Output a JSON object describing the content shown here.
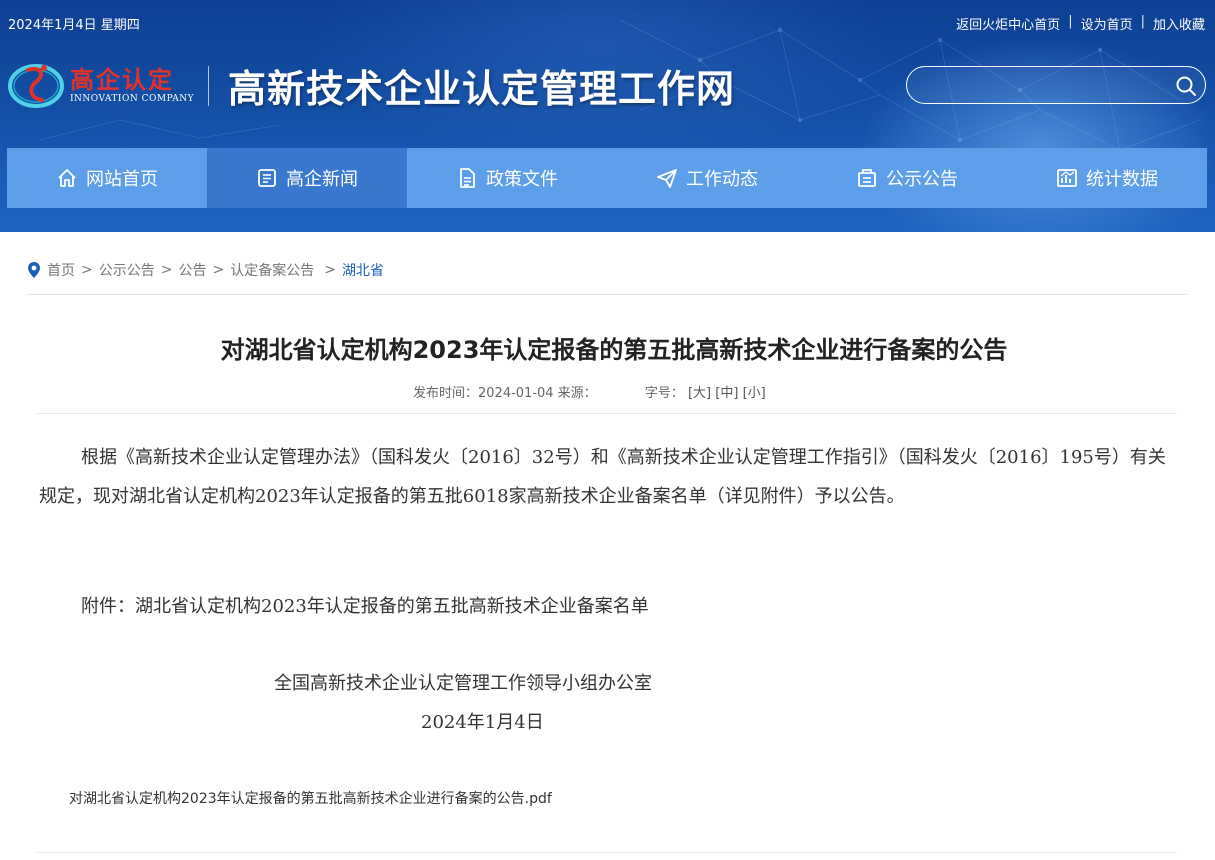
{
  "topbar": {
    "date": "2024年1月4日 星期四",
    "links": [
      "返回火炬中心首页",
      "设为首页",
      "加入收藏"
    ]
  },
  "logo": {
    "cn": "高企认定",
    "en": "INNOVATION COMPANY",
    "icon": "logo-ring-icon"
  },
  "site_title": "高新技术企业认定管理工作网",
  "search": {
    "placeholder": ""
  },
  "nav": {
    "items": [
      {
        "label": "网站首页",
        "icon": "home-icon"
      },
      {
        "label": "高企新闻",
        "icon": "news-icon"
      },
      {
        "label": "政策文件",
        "icon": "document-icon"
      },
      {
        "label": "工作动态",
        "icon": "paper-plane-icon"
      },
      {
        "label": "公示公告",
        "icon": "notice-icon"
      },
      {
        "label": "统计数据",
        "icon": "chart-icon"
      }
    ],
    "active_index": 1
  },
  "breadcrumb": {
    "items": [
      "首页",
      "公示公告",
      "公告",
      "认定备案公告"
    ],
    "current": "湖北省"
  },
  "article": {
    "title": "对湖北省认定机构2023年认定报备的第五批高新技术企业进行备案的公告",
    "meta_publish": "发布时间：2024-01-04 来源：",
    "meta_fontsize_label": "字号：",
    "font_sizes": [
      "[大]",
      "[中]",
      "[小]"
    ],
    "paragraph1": "根据《高新技术企业认定管理办法》（国科发火〔2016〕32号）和《高新技术企业认定管理工作指引》（国科发火〔2016〕195号）有关规定，现对湖北省认定机构2023年认定报备的第五批6018家高新技术企业备案名单（详见附件）予以公告。",
    "attachment": "附件：湖北省认定机构2023年认定报备的第五批高新技术企业备案名单",
    "org": "全国高新技术企业认定管理工作领导小组办公室",
    "sign_date": "2024年1月4日",
    "pdf_link": "对湖北省认定机构2023年认定报备的第五批高新技术企业进行备案的公告.pdf"
  },
  "colors": {
    "header_top": "#0d3f93",
    "nav_bg": "#5d9ee8",
    "nav_active": "#3a78cf",
    "breadcrumb_current": "#1d5fb8",
    "logo_red": "#e0322a"
  }
}
